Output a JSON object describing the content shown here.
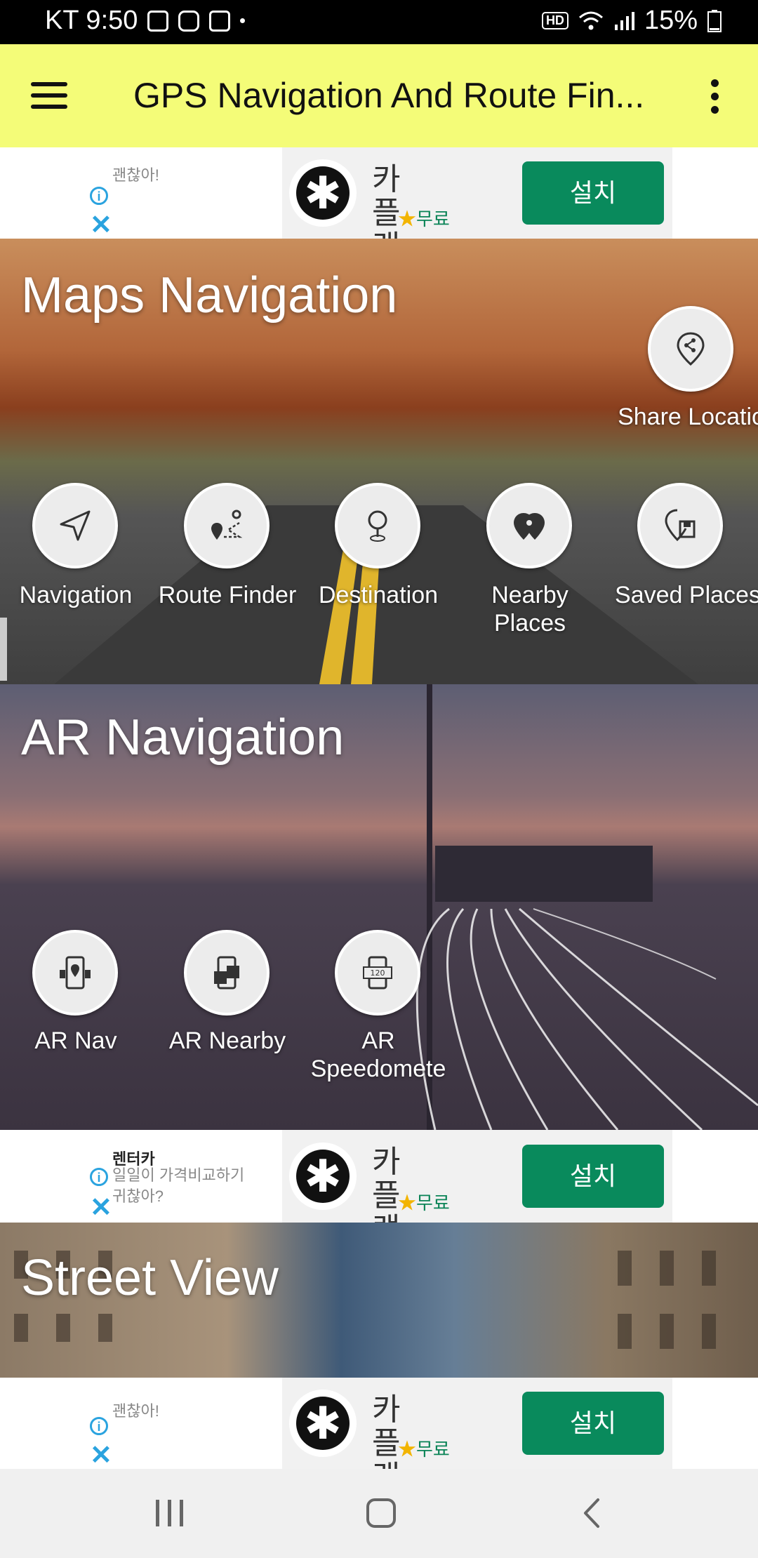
{
  "status_bar": {
    "carrier_time": "KT 9:50",
    "left_icons": [
      "image-icon",
      "instagram-icon",
      "message-icon",
      "dot-icon"
    ],
    "hd": "HD",
    "battery": "15%"
  },
  "toolbar": {
    "title": "GPS Navigation And Route Fin...",
    "bg_color": "#f4fc78"
  },
  "ads": [
    {
      "tiny_text": "괜찮아!",
      "app_name": "카플랫",
      "rating": "★",
      "price": "무료",
      "install": "설치"
    },
    {
      "tiny_title": "렌터카",
      "tiny_text": "일일이 가격비교하기 귀찮아?",
      "app_name": "카플랫",
      "rating": "★",
      "price": "무료",
      "install": "설치"
    },
    {
      "tiny_text": "괜찮아!",
      "app_name": "카플랫",
      "rating": "★",
      "price": "무료",
      "install": "설치"
    }
  ],
  "maps_navigation": {
    "title": "Maps Navigation",
    "share": "Share Locatio",
    "items": [
      "Navigation",
      "Route Finder",
      "Destination",
      "Nearby Places",
      "Saved Places"
    ]
  },
  "ar_navigation": {
    "title": "AR Navigation",
    "items": [
      "AR Nav",
      "AR Nearby",
      "AR Speedomete"
    ]
  },
  "street_view": {
    "title": "Street View"
  },
  "colors": {
    "install_button": "#098a5c",
    "ad_icon": "#2aa3df"
  }
}
